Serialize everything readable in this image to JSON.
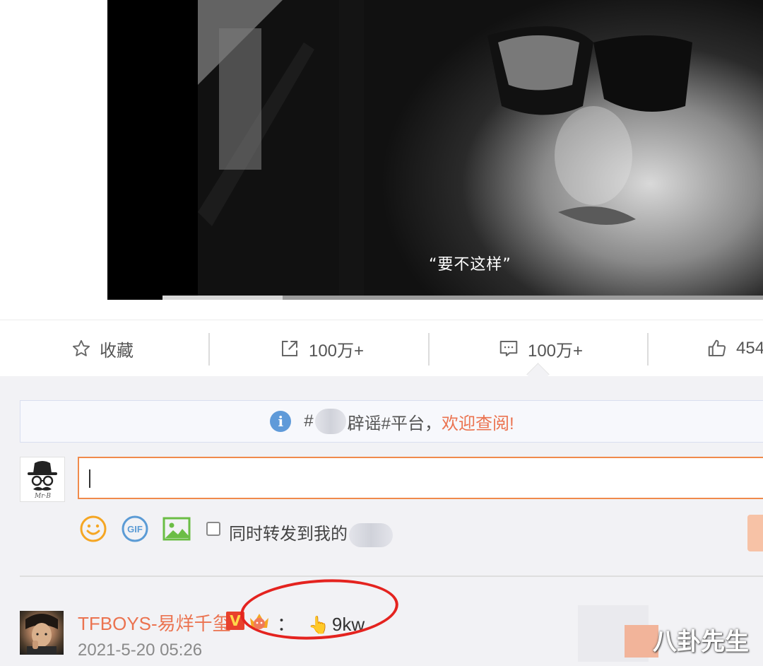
{
  "video": {
    "subtitle": "“要不这样”",
    "progress": 0.2
  },
  "actions": {
    "favorite_label": "收藏",
    "repost_count": "100万+",
    "comment_count": "100万+",
    "like_count": "454"
  },
  "notice": {
    "prefix": "#",
    "middle": "辟谣#平台，",
    "highlight": "欢迎查阅!"
  },
  "me": {
    "avatar_signature": "Mr·B"
  },
  "composer": {
    "input_value": "",
    "forward_label": "同时转发到我的"
  },
  "comment": {
    "user": "TFBOYS-易烊千玺",
    "v_badge": "V",
    "colon": "：",
    "hand_icon": "👆",
    "text": "9kw",
    "time": "2021-5-20 05:26"
  },
  "watermark": "八卦先生",
  "colors": {
    "accent": "#eb7350",
    "input_border": "#f08a4b",
    "circle": "#e4231f"
  }
}
